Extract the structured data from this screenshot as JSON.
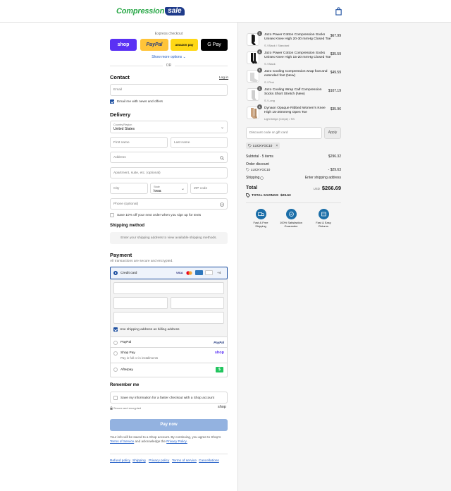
{
  "brand": {
    "logo_word": "Compression",
    "logo_badge": "sale"
  },
  "express": {
    "title": "Express checkout",
    "shop_label": "shop",
    "paypal_label": "PayPal",
    "amazon_label": "amazon pay",
    "gpay_label": "G Pay",
    "more": "Show more options",
    "or": "OR"
  },
  "contact": {
    "title": "Contact",
    "login": "Log in",
    "email_placeholder": "Email",
    "news_label": "Email me with news and offers"
  },
  "delivery": {
    "title": "Delivery",
    "country_label": "Country/Region",
    "country_value": "United States",
    "first_name": "First name",
    "last_name": "Last name",
    "address": "Address",
    "apartment": "Apartment, suite, etc. (optional)",
    "city": "City",
    "state_label": "State",
    "state_value": "Iowa",
    "zip": "ZIP code",
    "phone": "Phone (optional)",
    "sms_label": "Save 10% off your next order when you sign up for texts"
  },
  "shipping_method": {
    "title": "Shipping method",
    "note": "Enter your shipping address to view available shipping methods."
  },
  "payment": {
    "title": "Payment",
    "subtitle": "All transactions are secure and encrypted.",
    "credit_card": "Credit card",
    "card_more": "+4",
    "billing_same": "Use shipping address as billing address",
    "paypal": "PayPal",
    "paypal_logo": "PayPal",
    "shoppay": "Shop Pay",
    "shoppay_sub": "Pay in full or in installments",
    "shoppay_logo": "shop",
    "afterpay": "Afterpay"
  },
  "remember": {
    "title": "Remember me",
    "save_label": "Save my information for a faster checkout with a Shop account",
    "secure": "Secure and encrypted",
    "shop_logo": "shop"
  },
  "pay_now": "Pay now",
  "legal": {
    "line1": "Your info will be saved to a Shop account. By continuing, you agree to Shop's",
    "terms": "Terms of Service",
    "and": "and acknowledge the",
    "privacy": "Privacy Policy."
  },
  "footer": [
    "Refund policy",
    "Shipping",
    "Privacy policy",
    "Terms of service",
    "Cancellations"
  ],
  "items": [
    {
      "qty": "1",
      "name": "Jozo Power Cotton Compression Socks Unisex Knee High 20-30 mmHg Closed Toe",
      "variant": "S / Black / Standard",
      "price": "$67.99"
    },
    {
      "qty": "1",
      "name": "Jozo Power Cotton Compression Socks Unisex Knee High 15-20 mmHg Closed Toe",
      "variant": "S / Black",
      "price": "$35.59"
    },
    {
      "qty": "1",
      "name": "Jozo Cooling Compression wrap foot and extended foot (New)",
      "variant": "S / Pink",
      "price": "$49.59"
    },
    {
      "qty": "1",
      "name": "Jozo Cooling Wrap Calf Compression Socks Short Stretch (New)",
      "variant": "S / Long",
      "price": "$107.19"
    },
    {
      "qty": "1",
      "name": "Dynaon Opaque Ribbed Women's Knee High 15-20mmHg Open Toe",
      "variant": "Light beige (Crepe) / SS",
      "price": "$35.96"
    }
  ],
  "discount": {
    "placeholder": "Discount code or gift card",
    "apply": "Apply",
    "tag": "LUCKYGC10"
  },
  "totals": {
    "subtotal_label": "Subtotal · 5 items",
    "subtotal": "$296.32",
    "order_discount_label": "Order discount",
    "discount_code": "LUCKYGC10",
    "discount_value": "- $29.63",
    "shipping_label": "Shipping",
    "shipping_value": "Enter shipping address",
    "total_label": "Total",
    "currency": "USD",
    "total": "$266.69",
    "savings_label": "TOTAL SAVINGS",
    "savings": "$29.63"
  },
  "badges": [
    {
      "line1": "Fast & Free",
      "line2": "Shipping"
    },
    {
      "line1": "100% Satisfaction",
      "line2": "Guarantee"
    },
    {
      "line1": "Fast & Easy",
      "line2": "Returns"
    }
  ],
  "colors": {
    "shop": "#5a31f4",
    "paypal": "#ffc439",
    "amazon": "#ffd814",
    "gpay": "#000000",
    "accent": "#1d4fa0",
    "pay_now": "#93b2e0"
  }
}
